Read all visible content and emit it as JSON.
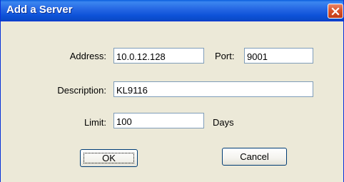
{
  "window": {
    "title": "Add a Server"
  },
  "form": {
    "address": {
      "label": "Address:",
      "value": "10.0.12.128"
    },
    "port": {
      "label": "Port:",
      "value": "9001"
    },
    "description": {
      "label": "Description:",
      "value": "KL9116"
    },
    "limit": {
      "label": "Limit:",
      "value": "100",
      "unit": "Days"
    }
  },
  "buttons": {
    "ok_label": "OK",
    "cancel_label": "Cancel"
  },
  "icons": {
    "close": "close-icon"
  },
  "colors": {
    "dialog_background": "#ECE9D8",
    "titlebar": "#0A5EDD",
    "close_button": "#D9542B",
    "input_border": "#7F9DB9",
    "button_border": "#003C74"
  }
}
